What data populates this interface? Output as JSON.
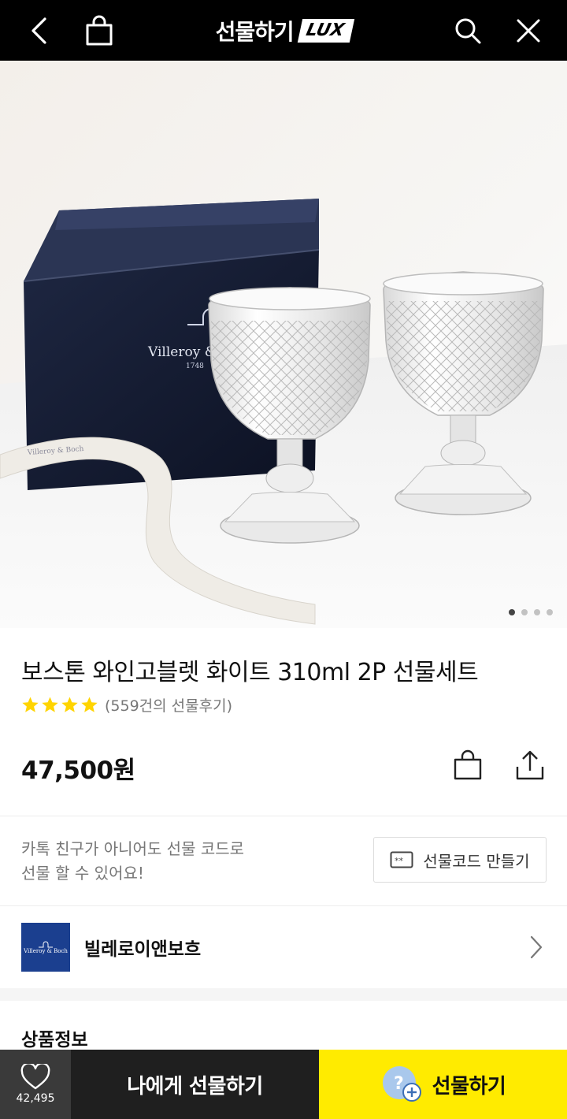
{
  "header": {
    "title": "선물하기",
    "badge": "LUX",
    "back_icon": "chevron-left-icon",
    "bag_icon": "shopping-bag-icon",
    "search_icon": "search-icon",
    "close_icon": "close-icon"
  },
  "hero": {
    "box_brand": "Villeroy & Boch",
    "box_year": "1748",
    "ribbon_text": "Villeroy & Boch",
    "page_count": 4,
    "current_page": 1
  },
  "product": {
    "title": "보스톤 와인고블렛 화이트 310ml 2P 선물세트",
    "rating_stars": 4,
    "review_count": "(559건의 선물후기)",
    "price": "47,500원"
  },
  "gift_code": {
    "description_line1": "카톡 친구가 아니어도 선물 코드로",
    "description_line2": "선물 할 수 있어요!",
    "button_label": "선물코드 만들기"
  },
  "brand": {
    "name": "빌레로이앤보흐",
    "logo_text": "Villeroy & Boch"
  },
  "section": {
    "title": "상품정보"
  },
  "bottom_bar": {
    "like_count": "42,495",
    "self_gift_label": "나에게 선물하기",
    "gift_label": "선물하기"
  },
  "colors": {
    "header_bg": "#000000",
    "star": "#ffd400",
    "gift_button": "#ffeb00",
    "self_gift_button": "#1f1f1f",
    "like_bg": "#3a3a3a",
    "brand_logo_bg": "#1b3f8f"
  }
}
